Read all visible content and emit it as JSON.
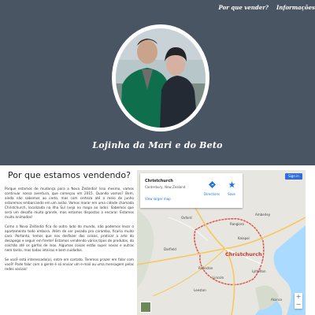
{
  "nav": {
    "items": [
      "Por que vender?",
      "Informações"
    ]
  },
  "site": {
    "title": "Lojinha da Mari e do Beto"
  },
  "content": {
    "heading": "Por que estamos vendendo?",
    "paragraphs": [
      "Porque estamos de mudança para a Nova Zelândia! Isso mesmo, vamos continuar nossa aventura, que começou em 2015. Quando vamos? Bem, ainda não sabemos ao certo, mas com certeza até o meio de junho estaremos embarcando em um avião. Vamos morar em uma cidade chamada Christchurch, localizada na Ilha Sul (veja no mapa ao lado). Sabemos que será um desafio muito grande, mas estamos dispostos a encarar. Estamos muito animados!",
      "Como a Nova Zelândia fica do outro lado do mundo, não podemos levar o apartamento todo embora. Além de ser pesado pra caramba, ficaria muito caro. Portanto, temos que nos desfazer das coisas, praticar a arte do desapego e seguir em frente! Estamos vendendo vários tipos de produtos, do colchão até os garfos de inox. Algumas coisas estão super novas e outras nem tanto, mas todas inteiras e bem cuidadas.",
      "Se você está interessado(a), entre em contato. Teremos prazer em falar com você! Pode falar com a gente é só enviar um e-mail ou uma mensagem pelas redes sociais!"
    ]
  },
  "map": {
    "place": "Christchurch",
    "region": "Canterbury, New Zealand",
    "directions_label": "Directions",
    "save_label": "Save",
    "larger_map_label": "View larger map",
    "signin_label": "Sign in",
    "city_label": "Christchurch",
    "towns": [
      "Oxford",
      "Rangiora",
      "Kaiapoi",
      "Darfield",
      "Rolleston",
      "Lincoln",
      "Lyttelton",
      "Akaroa",
      "Leeston",
      "Amberley"
    ],
    "colors": {
      "land": "#e8e6e1",
      "water": "#aadaff",
      "boundary": "#e0544a",
      "road": "#f7c65a"
    }
  }
}
